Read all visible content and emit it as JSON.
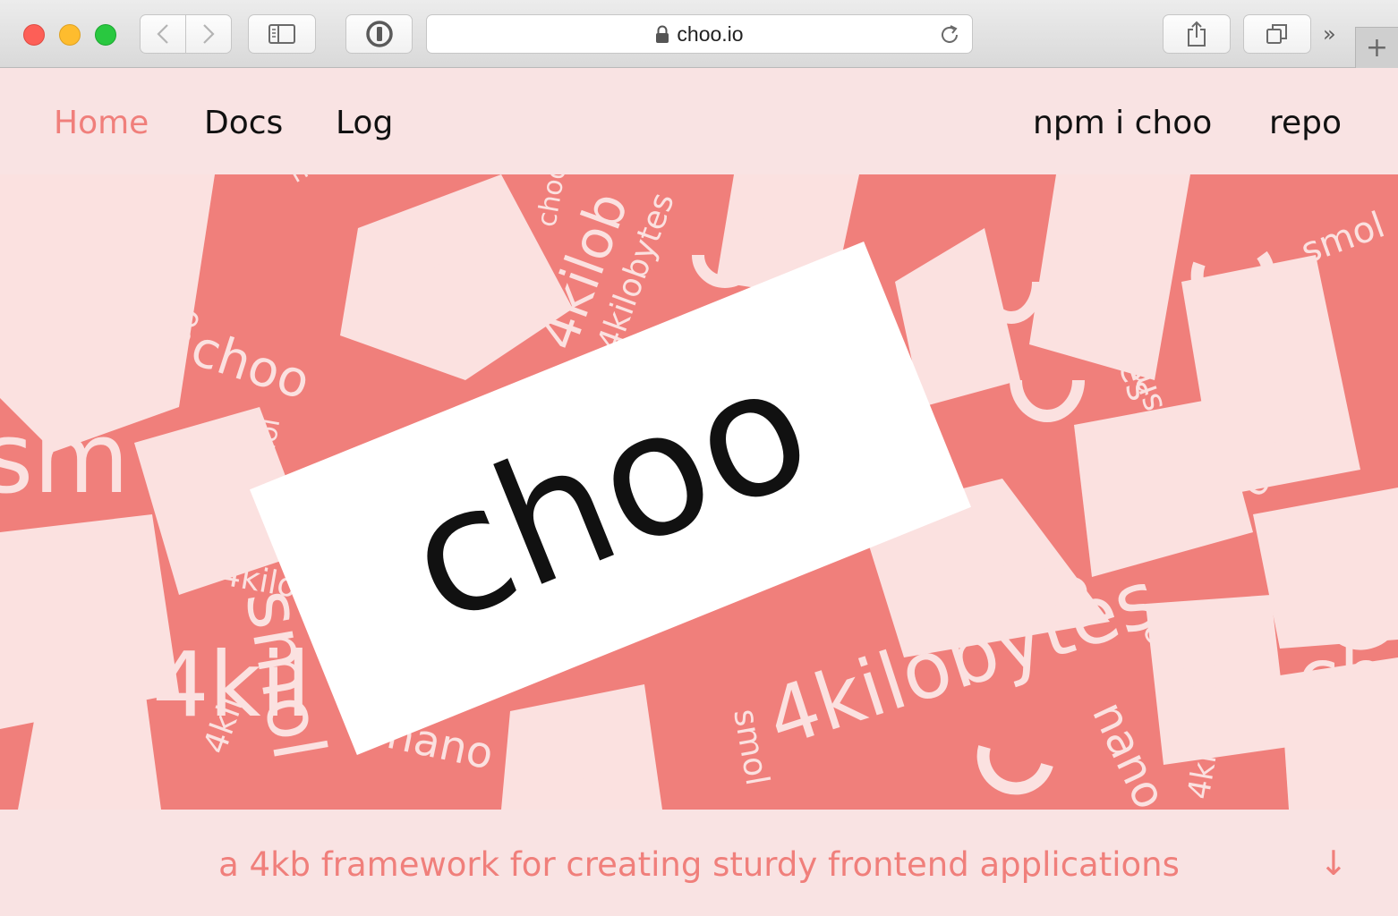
{
  "browser": {
    "url": "choo.io",
    "icons": {
      "back": "chevron-left-icon",
      "forward": "chevron-right-icon",
      "sidebar": "sidebar-icon",
      "password": "password-manager-icon",
      "lock": "lock-icon",
      "reload": "reload-icon",
      "share": "share-icon",
      "tabs": "tab-overview-icon",
      "more": "chevron-double-right-icon",
      "new_tab": "plus-icon"
    },
    "more_glyph": "»",
    "new_tab_glyph": "+"
  },
  "nav": {
    "home": "Home",
    "docs": "Docs",
    "log": "Log",
    "install": "npm i choo",
    "repo": "repo"
  },
  "hero": {
    "title": "choo",
    "collage_words": {
      "w1": "choo",
      "w2": "nano",
      "w3": "4kilobytes",
      "w4": "smol",
      "w5": "4kilob",
      "w6": "nano",
      "w7": "smol",
      "w8": "choo",
      "w9": "4kilobytes",
      "w10": "smol",
      "w11": "choo",
      "w12": "nano",
      "w13": "4kilobytes",
      "w14": "choo",
      "w15": "smol",
      "w16": "kilobytes",
      "w17": "nano",
      "w18": "choo",
      "w19": "4kil",
      "w20": "smol",
      "w21": "4kilobytes",
      "w22": "nano",
      "w23": "choo",
      "w24": "sm",
      "w25": "4kil",
      "w26": "choo",
      "w27": "nano",
      "w28": "smol",
      "w29": "4kilo",
      "w30": "choo"
    }
  },
  "tagline": "a 4kb framework for creating sturdy frontend applications",
  "down_arrow": "↓",
  "colors": {
    "accent": "#f07f7b",
    "page_bg": "#f9e3e3",
    "pale": "#fbe1e0",
    "title_text": "#111111"
  }
}
